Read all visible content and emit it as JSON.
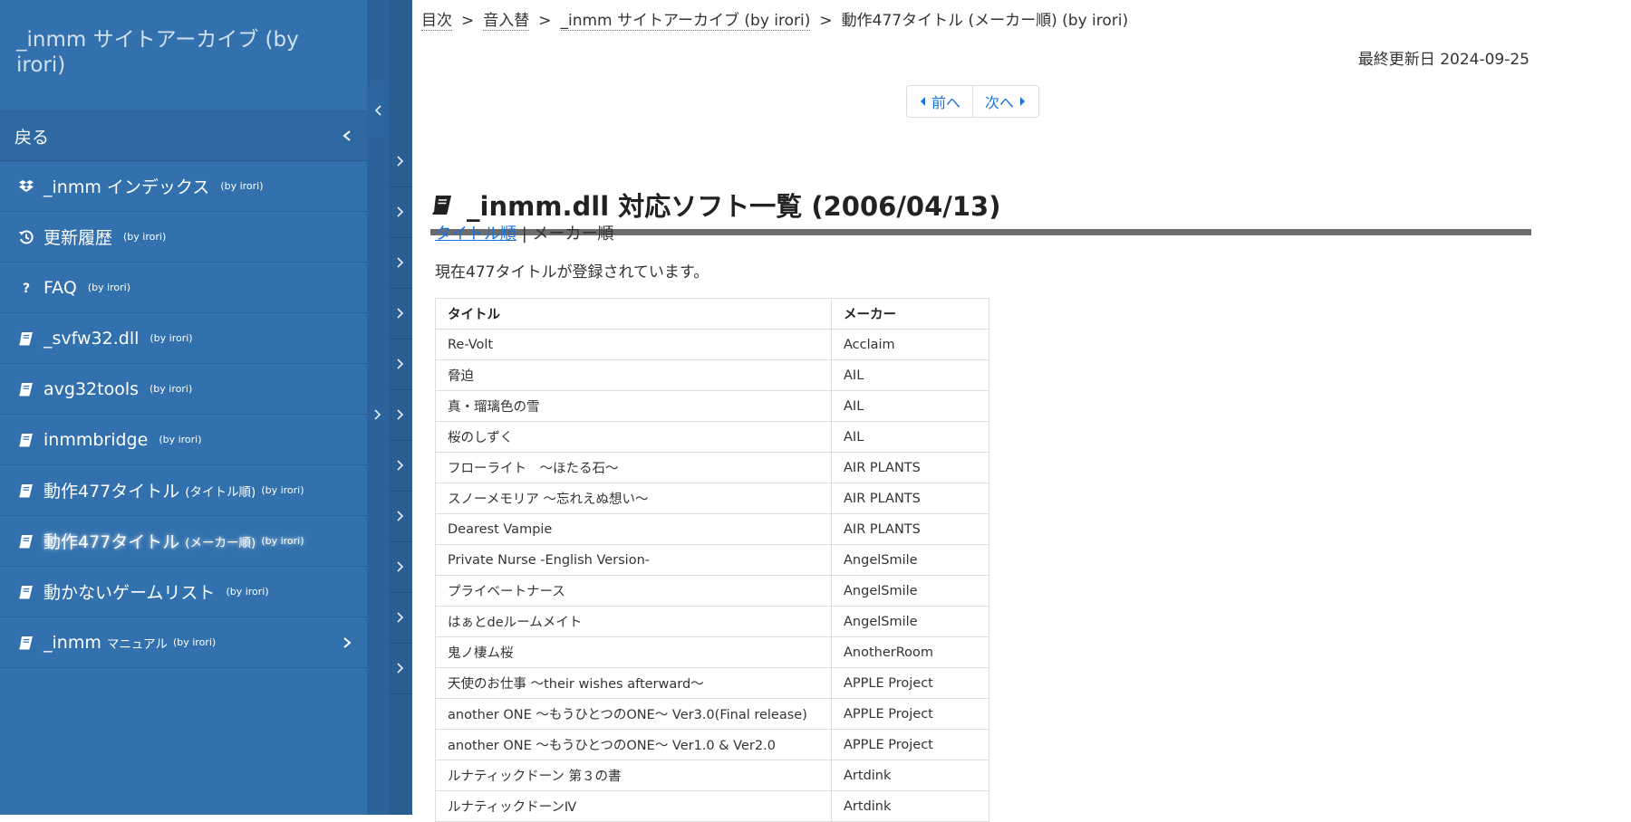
{
  "site": {
    "title": "_inmm サイトアーカイブ (by irori)"
  },
  "menu": {
    "back_label": "戻る",
    "items": [
      {
        "label": "_inmm インデックス",
        "sub": "",
        "by": "(by irori)",
        "icon": "dropbox-icon"
      },
      {
        "label": "更新履歴",
        "sub": "",
        "by": "(by irori)",
        "icon": "history-icon"
      },
      {
        "label": "FAQ",
        "sub": "",
        "by": "(by irori)",
        "icon": "question-icon"
      },
      {
        "label": "_svfw32.dll",
        "sub": "",
        "by": "(by irori)",
        "icon": "book-icon"
      },
      {
        "label": "avg32tools",
        "sub": "",
        "by": "(by irori)",
        "icon": "book-icon"
      },
      {
        "label": "inmmbridge",
        "sub": "",
        "by": "(by irori)",
        "icon": "book-icon"
      },
      {
        "label": "動作477タイトル",
        "sub": "(タイトル順)",
        "by": "(by irori)",
        "icon": "book-icon"
      },
      {
        "label": "動作477タイトル",
        "sub": "(メーカー順)",
        "by": "(by irori)",
        "icon": "book-icon",
        "active": true
      },
      {
        "label": "動かないゲームリスト",
        "sub": "",
        "by": "(by irori)",
        "icon": "book-icon"
      },
      {
        "label": "_inmm",
        "sub": "マニュアル",
        "by": "(by irori)",
        "icon": "book-icon",
        "has_children": true
      }
    ]
  },
  "breadcrumb": {
    "items": [
      "目次",
      "音入替",
      "_inmm サイトアーカイブ (by irori)"
    ],
    "current": "動作477タイトル (メーカー順) (by irori)",
    "separator": ">"
  },
  "last_updated": "最終更新日 2024-09-25",
  "pager": {
    "prev": "前へ",
    "next": "次へ"
  },
  "page": {
    "heading": "_inmm.dll 対応ソフト一覧 (2006/04/13)",
    "sort_title_link": "タイトル順",
    "sort_separator": "|",
    "sort_current": "メーカー順",
    "count_text": "現在477タイトルが登録されています。"
  },
  "table": {
    "headers": [
      "タイトル",
      "メーカー"
    ],
    "rows": [
      [
        "Re-Volt",
        "Acclaim"
      ],
      [
        "脅迫",
        "AIL"
      ],
      [
        "真・瑠璃色の雪",
        "AIL"
      ],
      [
        "桜のしずく",
        "AIL"
      ],
      [
        "フローライト　～ほたる石～",
        "AIR PLANTS"
      ],
      [
        "スノーメモリア ～忘れえぬ想い～",
        "AIR PLANTS"
      ],
      [
        "Dearest Vampie",
        "AIR PLANTS"
      ],
      [
        "Private Nurse -English Version-",
        "AngelSmile"
      ],
      [
        "プライベートナース",
        "AngelSmile"
      ],
      [
        "はぁとdeルームメイト",
        "AngelSmile"
      ],
      [
        "鬼ノ棲ム桜",
        "AnotherRoom"
      ],
      [
        "天使のお仕事 ～their wishes afterward～",
        "APPLE Project"
      ],
      [
        "another ONE ～もうひとつのONE～ Ver3.0(Final release)",
        "APPLE Project"
      ],
      [
        "another ONE ～もうひとつのONE～ Ver1.0 & Ver2.0",
        "APPLE Project"
      ],
      [
        "ルナティックドーン 第３の書",
        "Artdink"
      ],
      [
        "ルナティックドーンⅣ",
        "Artdink"
      ]
    ]
  },
  "colors": {
    "menu_bg": "#3271ad",
    "link": "#1a73d8",
    "heading_rule": "#6c6c6c"
  }
}
